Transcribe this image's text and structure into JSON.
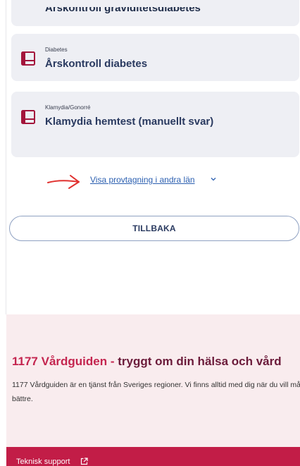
{
  "cards": {
    "top_partial_title": "Årskontroll graviditetsdiabetes",
    "items": [
      {
        "category": "Diabetes",
        "title": "Årskontroll diabetes",
        "icon": "document-icon"
      },
      {
        "category": "Klamydia/Gonorré",
        "title": "Klamydia hemtest (manuellt svar)",
        "icon": "document-icon"
      }
    ]
  },
  "more_link": {
    "label": "Visa provtagning i andra län",
    "icon": "chevron-down-icon"
  },
  "annotation": {
    "icon": "red-arrow-icon",
    "color": "#e0312f"
  },
  "back_button": {
    "label": "TILLBAKA"
  },
  "footer": {
    "brand": "1177 Vårdguiden",
    "dash": " - ",
    "tagline": "tryggt om din hälsa och vård",
    "description": "1177 Vårdguiden är en tjänst från Sveriges regioner. Vi finns alltid med dig när du vill må bättre.",
    "support_link": "Teknisk support",
    "support_icon": "external-link-icon"
  },
  "colors": {
    "card_bg": "#eeeff4",
    "link": "#2b5fb0",
    "brand": "#c4254f",
    "footer_bg": "#f9ecee",
    "support_bar": "#c21d47"
  }
}
